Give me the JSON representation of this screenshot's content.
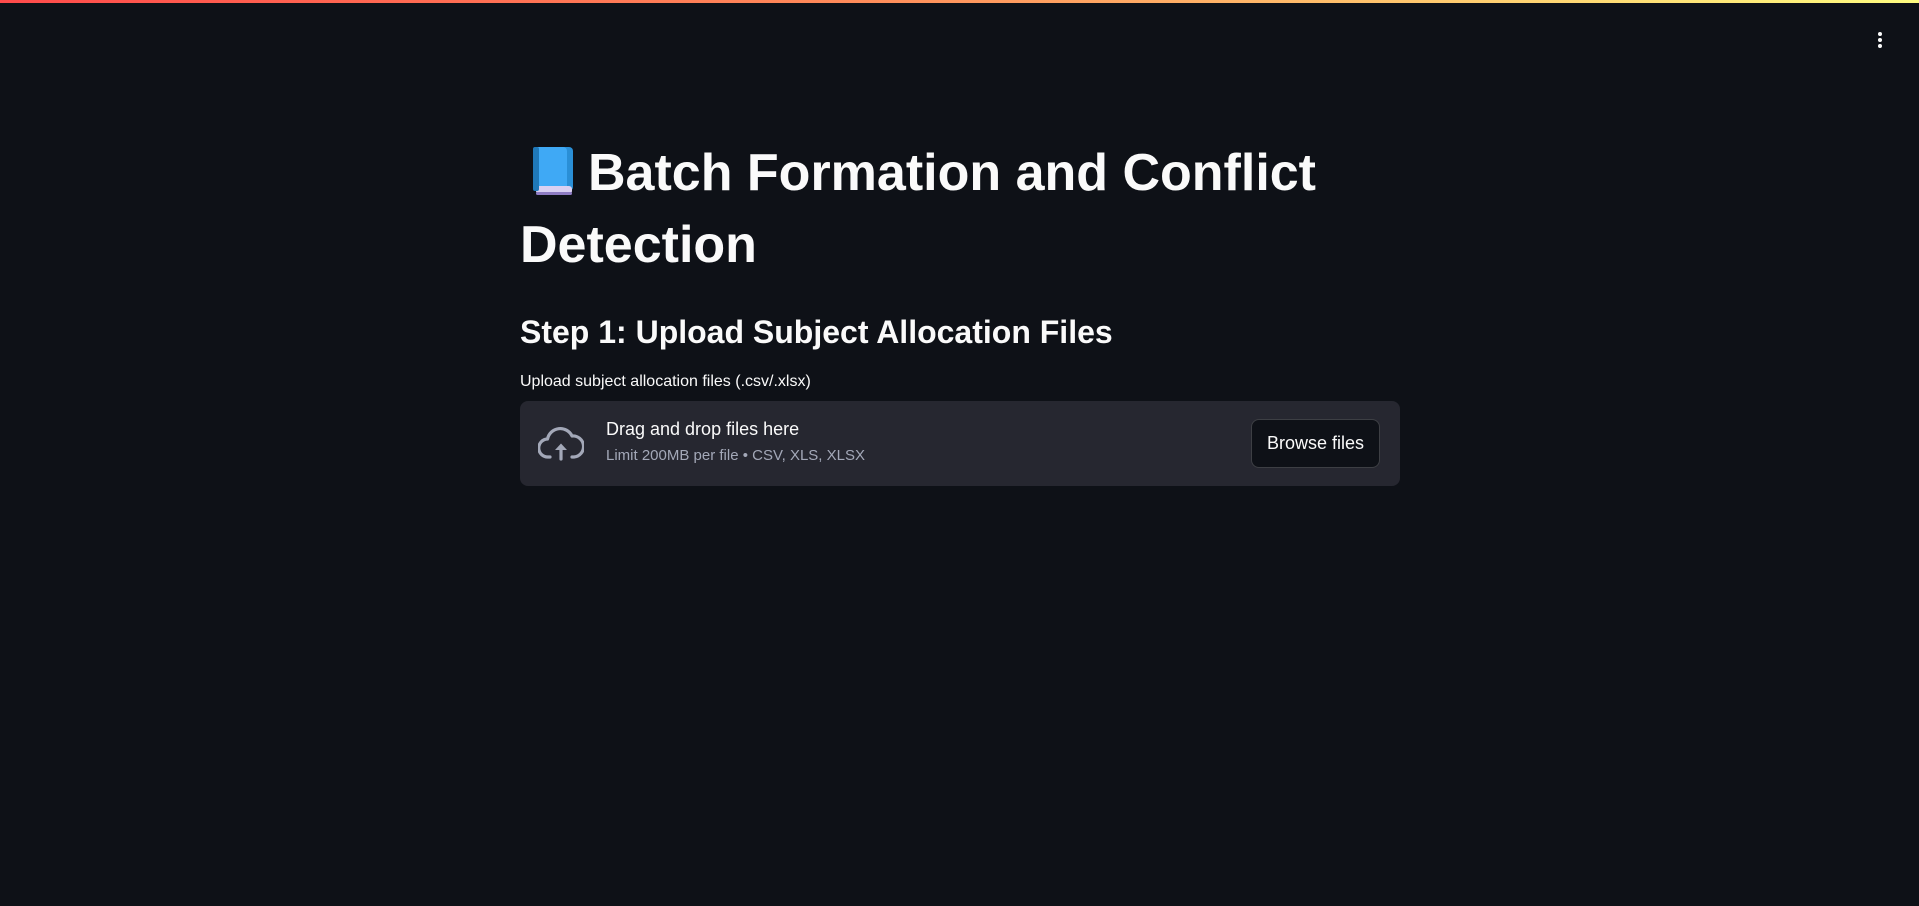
{
  "header": {
    "menu_icon": "more-vertical-icon",
    "stripe_colors": [
      "#ff4b4b",
      "#fffd80"
    ]
  },
  "main": {
    "title_icon": "blue-book-icon",
    "title": "Batch Formation and Conflict Detection",
    "step_heading": "Step 1: Upload Subject Allocation Files",
    "uploader": {
      "label": "Upload subject allocation files (.csv/.xlsx)",
      "icon": "cloud-upload-icon",
      "instructions": "Drag and drop files here",
      "limit": "Limit 200MB per file • CSV, XLS, XLSX",
      "browse_label": "Browse files"
    }
  },
  "colors": {
    "background": "#0e1117",
    "dropzone": "#262730",
    "text": "#fafafa",
    "muted_text": "#a3a8b8"
  }
}
